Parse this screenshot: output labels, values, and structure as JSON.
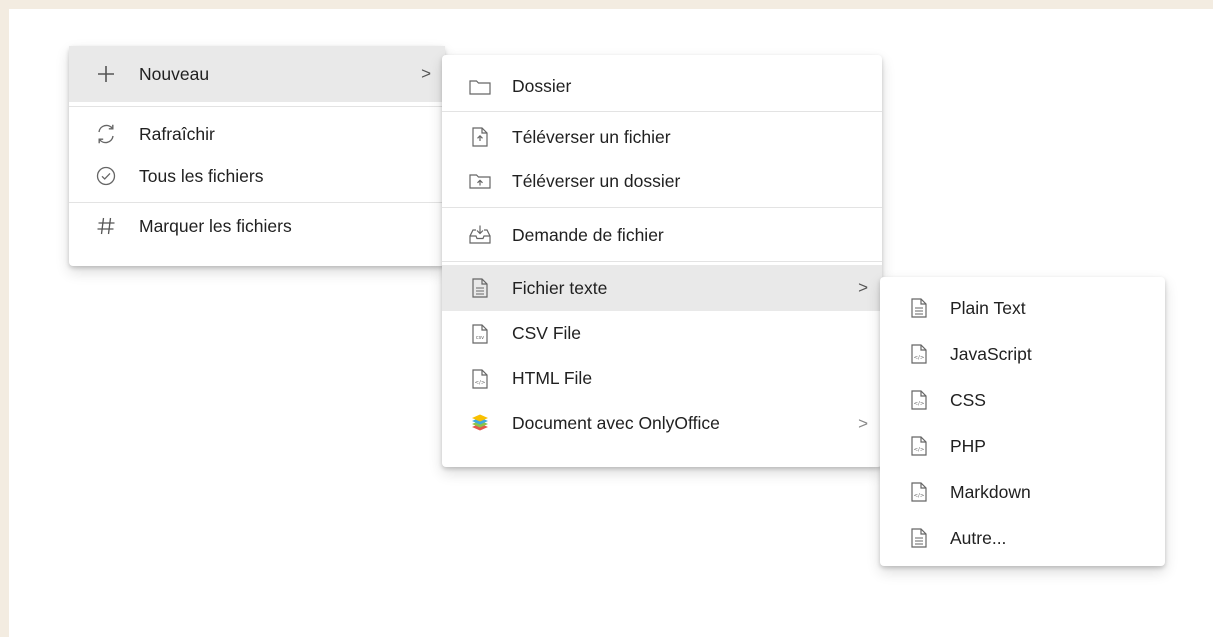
{
  "main_menu": {
    "items": [
      {
        "label": "Nouveau",
        "icon": "plus-icon",
        "chevron": ">"
      },
      {
        "label": "Rafraîchir",
        "icon": "refresh-icon"
      },
      {
        "label": "Tous les fichiers",
        "icon": "check-circle-icon"
      },
      {
        "label": "Marquer les fichiers",
        "icon": "hash-icon"
      }
    ]
  },
  "new_menu": {
    "items": [
      {
        "label": "Dossier",
        "icon": "folder-icon"
      },
      {
        "label": "Téléverser un fichier",
        "icon": "file-upload-icon"
      },
      {
        "label": "Téléverser un dossier",
        "icon": "folder-upload-icon"
      },
      {
        "label": "Demande de fichier",
        "icon": "inbox-download-icon"
      },
      {
        "label": "Fichier texte",
        "icon": "text-file-icon",
        "chevron": ">"
      },
      {
        "label": "CSV File",
        "icon": "csv-file-icon",
        "icon_text": "csv"
      },
      {
        "label": "HTML File",
        "icon": "code-file-icon",
        "icon_text": "</>"
      },
      {
        "label": "Document avec OnlyOffice",
        "icon": "onlyoffice-icon",
        "chevron": ">"
      }
    ]
  },
  "text_menu": {
    "items": [
      {
        "label": "Plain Text",
        "icon": "text-file-icon"
      },
      {
        "label": "JavaScript",
        "icon": "code-file-icon",
        "icon_text": "</>"
      },
      {
        "label": "CSS",
        "icon": "code-file-icon",
        "icon_text": "</>"
      },
      {
        "label": "PHP",
        "icon": "code-file-icon",
        "icon_text": "</>"
      },
      {
        "label": "Markdown",
        "icon": "code-file-icon",
        "icon_text": "</>"
      },
      {
        "label": "Autre...",
        "icon": "text-file-icon"
      }
    ]
  },
  "colors": {
    "background": "#f3ece1",
    "menu_background": "#ffffff",
    "hover_background": "#e9e9e9",
    "icon_grey": "#616161",
    "onlyoffice_red": "#e2574c",
    "onlyoffice_green": "#8bc34a",
    "onlyoffice_blue": "#40a9e0",
    "onlyoffice_yellow": "#f9c000"
  }
}
